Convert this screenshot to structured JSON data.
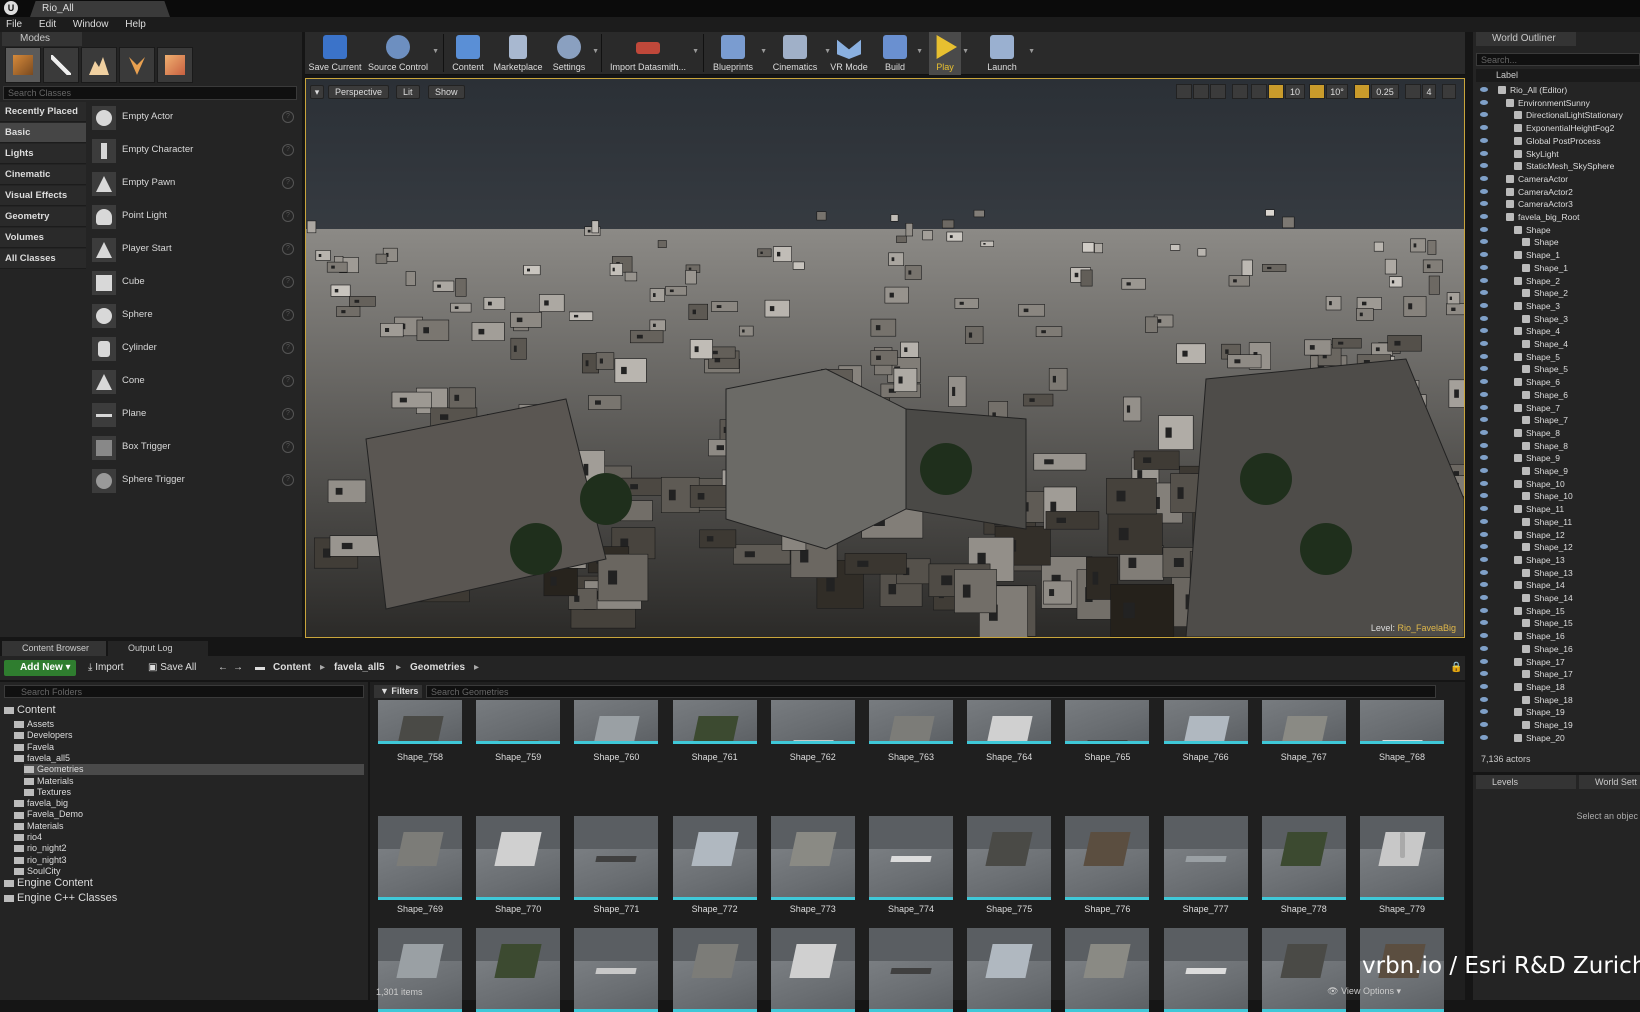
{
  "title_bar": {
    "tab": "Rio_All"
  },
  "menu": [
    "File",
    "Edit",
    "Window",
    "Help"
  ],
  "modes": {
    "tab": "Modes",
    "search_placeholder": "Search Classes",
    "categories": [
      "Recently Placed",
      "Basic",
      "Lights",
      "Cinematic",
      "Visual Effects",
      "Geometry",
      "Volumes",
      "All Classes"
    ],
    "active_category": "Basic",
    "items": [
      "Empty Actor",
      "Empty Character",
      "Empty Pawn",
      "Point Light",
      "Player Start",
      "Cube",
      "Sphere",
      "Cylinder",
      "Cone",
      "Plane",
      "Box Trigger",
      "Sphere Trigger"
    ]
  },
  "toolbar": {
    "buttons": [
      {
        "label": "Save Current",
        "icon": "save-icon",
        "color": "#3b73c9"
      },
      {
        "label": "Source Control",
        "icon": "source-control-icon",
        "color": "#6d8fc0"
      },
      {
        "label": "Content",
        "icon": "content-icon",
        "color": "#5a8fd6"
      },
      {
        "label": "Marketplace",
        "icon": "marketplace-icon",
        "color": "#a8b8d0"
      },
      {
        "label": "Settings",
        "icon": "settings-icon",
        "color": "#8aa0c0"
      },
      {
        "label": "Import Datasmith...",
        "icon": "datasmith-icon",
        "color": "#c0483a"
      },
      {
        "label": "Blueprints",
        "icon": "blueprints-icon",
        "color": "#7a9cd0"
      },
      {
        "label": "Cinematics",
        "icon": "cinematics-icon",
        "color": "#a0b0c8"
      },
      {
        "label": "VR Mode",
        "icon": "vr-mode-icon",
        "color": "#8ab0e0"
      },
      {
        "label": "Build",
        "icon": "build-icon",
        "color": "#6a90d0"
      },
      {
        "label": "Play",
        "icon": "play-icon",
        "color": "#e8c030"
      },
      {
        "label": "Launch",
        "icon": "launch-icon",
        "color": "#9ab0d0"
      }
    ]
  },
  "viewport": {
    "perspective": "Perspective",
    "lit": "Lit",
    "show": "Show",
    "grid_snap": "10",
    "rotation_snap": "10°",
    "scale_snap": "0.25",
    "camera_speed": "4",
    "level_label": "Level:",
    "level_name": "Rio_FavelaBig",
    "accent": "#c9a53b"
  },
  "outliner": {
    "tab": "World Outliner",
    "search_placeholder": "Search...",
    "column": "Label",
    "rows": [
      {
        "label": "Rio_All (Editor)",
        "depth": 0
      },
      {
        "label": "EnvironmentSunny",
        "depth": 1
      },
      {
        "label": "DirectionalLightStationary",
        "depth": 2
      },
      {
        "label": "ExponentialHeightFog2",
        "depth": 2
      },
      {
        "label": "Global PostProcess",
        "depth": 2
      },
      {
        "label": "SkyLight",
        "depth": 2
      },
      {
        "label": "StaticMesh_SkySphere",
        "depth": 2
      },
      {
        "label": "CameraActor",
        "depth": 1
      },
      {
        "label": "CameraActor2",
        "depth": 1
      },
      {
        "label": "CameraActor3",
        "depth": 1
      },
      {
        "label": "favela_big_Root",
        "depth": 1
      },
      {
        "label": "Shape",
        "depth": 2
      },
      {
        "label": "Shape",
        "depth": 3
      },
      {
        "label": "Shape_1",
        "depth": 2
      },
      {
        "label": "Shape_1",
        "depth": 3
      },
      {
        "label": "Shape_2",
        "depth": 2
      },
      {
        "label": "Shape_2",
        "depth": 3
      },
      {
        "label": "Shape_3",
        "depth": 2
      },
      {
        "label": "Shape_3",
        "depth": 3
      },
      {
        "label": "Shape_4",
        "depth": 2
      },
      {
        "label": "Shape_4",
        "depth": 3
      },
      {
        "label": "Shape_5",
        "depth": 2
      },
      {
        "label": "Shape_5",
        "depth": 3
      },
      {
        "label": "Shape_6",
        "depth": 2
      },
      {
        "label": "Shape_6",
        "depth": 3
      },
      {
        "label": "Shape_7",
        "depth": 2
      },
      {
        "label": "Shape_7",
        "depth": 3
      },
      {
        "label": "Shape_8",
        "depth": 2
      },
      {
        "label": "Shape_8",
        "depth": 3
      },
      {
        "label": "Shape_9",
        "depth": 2
      },
      {
        "label": "Shape_9",
        "depth": 3
      },
      {
        "label": "Shape_10",
        "depth": 2
      },
      {
        "label": "Shape_10",
        "depth": 3
      },
      {
        "label": "Shape_11",
        "depth": 2
      },
      {
        "label": "Shape_11",
        "depth": 3
      },
      {
        "label": "Shape_12",
        "depth": 2
      },
      {
        "label": "Shape_12",
        "depth": 3
      },
      {
        "label": "Shape_13",
        "depth": 2
      },
      {
        "label": "Shape_13",
        "depth": 3
      },
      {
        "label": "Shape_14",
        "depth": 2
      },
      {
        "label": "Shape_14",
        "depth": 3
      },
      {
        "label": "Shape_15",
        "depth": 2
      },
      {
        "label": "Shape_15",
        "depth": 3
      },
      {
        "label": "Shape_16",
        "depth": 2
      },
      {
        "label": "Shape_16",
        "depth": 3
      },
      {
        "label": "Shape_17",
        "depth": 2
      },
      {
        "label": "Shape_17",
        "depth": 3
      },
      {
        "label": "Shape_18",
        "depth": 2
      },
      {
        "label": "Shape_18",
        "depth": 3
      },
      {
        "label": "Shape_19",
        "depth": 2
      },
      {
        "label": "Shape_19",
        "depth": 3
      },
      {
        "label": "Shape_20",
        "depth": 2
      }
    ],
    "actor_count": "7,136 actors"
  },
  "levels": {
    "tab": "Levels",
    "world_settings_tab": "World Sett",
    "hint": "Select an objec"
  },
  "content_browser": {
    "tab": "Content Browser",
    "output_log_tab": "Output Log",
    "add_new": "Add New",
    "import": "Import",
    "save_all": "Save All",
    "breadcrumb": [
      "Content",
      "favela_all5",
      "Geometries"
    ],
    "search_folders_placeholder": "Search Folders",
    "filters": "Filters",
    "search_assets_placeholder": "Search Geometries",
    "folders": [
      {
        "label": "Content",
        "depth": 0,
        "big": true
      },
      {
        "label": "Assets",
        "depth": 1
      },
      {
        "label": "Developers",
        "depth": 1
      },
      {
        "label": "Favela",
        "depth": 1
      },
      {
        "label": "favela_all5",
        "depth": 1
      },
      {
        "label": "Geometries",
        "depth": 2,
        "selected": true
      },
      {
        "label": "Materials",
        "depth": 2
      },
      {
        "label": "Textures",
        "depth": 2
      },
      {
        "label": "favela_big",
        "depth": 1
      },
      {
        "label": "Favela_Demo",
        "depth": 1
      },
      {
        "label": "Materials",
        "depth": 1
      },
      {
        "label": "rio4",
        "depth": 1
      },
      {
        "label": "rio_night2",
        "depth": 1
      },
      {
        "label": "rio_night3",
        "depth": 1
      },
      {
        "label": "SoulCity",
        "depth": 1
      },
      {
        "label": "Engine Content",
        "depth": 0,
        "big": true
      },
      {
        "label": "Engine C++ Classes",
        "depth": 0,
        "big": true
      }
    ],
    "assets_row1": [
      "Shape_758",
      "Shape_759",
      "Shape_760",
      "Shape_761",
      "Shape_762",
      "Shape_763",
      "Shape_764",
      "Shape_765",
      "Shape_766",
      "Shape_767",
      "Shape_768"
    ],
    "assets_row2": [
      "Shape_769",
      "Shape_770",
      "Shape_771",
      "Shape_772",
      "Shape_773",
      "Shape_774",
      "Shape_775",
      "Shape_776",
      "Shape_777",
      "Shape_778",
      "Shape_779"
    ],
    "assets_row3_count": 11,
    "item_count": "1,301 items",
    "view_options": "View Options",
    "asset_accent": "#3fc8d8"
  },
  "watermark": "vrbn.io / Esri R&D Zurich"
}
